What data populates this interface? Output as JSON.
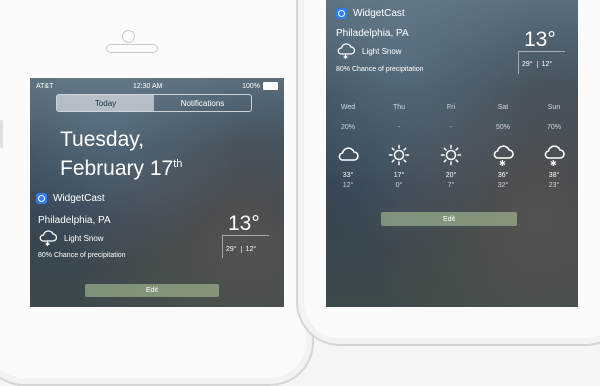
{
  "status_bar": {
    "carrier": "AT&T",
    "time": "12:30 AM",
    "battery": "100%"
  },
  "tabs": [
    {
      "label": "Today",
      "active": true
    },
    {
      "label": "Notifications",
      "active": false
    }
  ],
  "date": {
    "weekday": "Tuesday,",
    "month_day": "February 17",
    "suffix": "th"
  },
  "widget": {
    "name": "WidgetCast",
    "city": "Philadelphia, PA",
    "condition": "Light Snow",
    "chance": "80% Chance of precipitation",
    "temp": "13°",
    "high": "29°",
    "low": "12°",
    "edit_label": "Edit",
    "accent_color": "#2e7ef5"
  },
  "forecast": [
    {
      "day": "Wed",
      "chance": "20%",
      "icon": "cloud-icon",
      "high": "33°",
      "low": "12°"
    },
    {
      "day": "Thu",
      "chance": "-",
      "icon": "sun-icon",
      "high": "17°",
      "low": "0°"
    },
    {
      "day": "Fri",
      "chance": "-",
      "icon": "sun-icon",
      "high": "20°",
      "low": "7°"
    },
    {
      "day": "Sat",
      "chance": "50%",
      "icon": "snow-cloud-icon",
      "high": "36°",
      "low": "32°"
    },
    {
      "day": "Sun",
      "chance": "70%",
      "icon": "snow-cloud-icon",
      "high": "38°",
      "low": "23°"
    }
  ]
}
